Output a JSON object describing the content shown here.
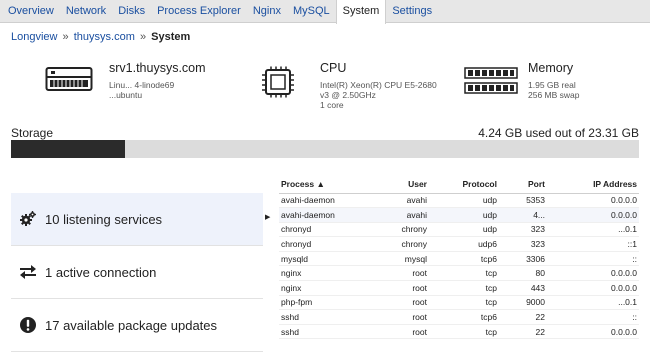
{
  "tabs": [
    {
      "label": "Overview",
      "active": false
    },
    {
      "label": "Network",
      "active": false
    },
    {
      "label": "Disks",
      "active": false
    },
    {
      "label": "Process Explorer",
      "active": false
    },
    {
      "label": "Nginx",
      "active": false
    },
    {
      "label": "MySQL",
      "active": false
    },
    {
      "label": "System",
      "active": true
    },
    {
      "label": "Settings",
      "active": false
    }
  ],
  "breadcrumb": {
    "root": "Longview",
    "host": "thuysys.com",
    "separator": "»",
    "current": "System"
  },
  "server": {
    "hostname": "srv1.thuysys.com",
    "line1": "Linu... 4-linode69",
    "line2": "...ubuntu"
  },
  "cpu": {
    "title": "CPU",
    "model": "Intel(R) Xeon(R) CPU E5-2680",
    "speed": "v3 @ 2.50GHz",
    "cores": "1 core"
  },
  "memory": {
    "title": "Memory",
    "real": "1.95 GB real",
    "swap": "256 MB swap"
  },
  "storage": {
    "label": "Storage",
    "used_text": "4.24 GB used out of 23.31 GB",
    "used_fraction": 0.182
  },
  "stats": [
    {
      "label": "10 listening services",
      "icon": "gears-icon",
      "active": true
    },
    {
      "label": "1 active connection",
      "icon": "arrows-exchange-icon",
      "active": false
    },
    {
      "label": "17 available package updates",
      "icon": "alert-circle-icon",
      "active": false
    }
  ],
  "table": {
    "headers": {
      "process": "Process ▲",
      "user": "User",
      "protocol": "Protocol",
      "port": "Port",
      "ip": "IP Address"
    },
    "rows": [
      {
        "process": "avahi-daemon",
        "user": "avahi",
        "protocol": "udp",
        "port": "5353",
        "ip": "0.0.0.0"
      },
      {
        "process": "avahi-daemon",
        "user": "avahi",
        "protocol": "udp",
        "port": "4...",
        "ip": "0.0.0.0"
      },
      {
        "process": "chronyd",
        "user": "chrony",
        "protocol": "udp",
        "port": "323",
        "ip": "...0.1"
      },
      {
        "process": "chronyd",
        "user": "chrony",
        "protocol": "udp6",
        "port": "323",
        "ip": "::1"
      },
      {
        "process": "mysqld",
        "user": "mysql",
        "protocol": "tcp6",
        "port": "3306",
        "ip": "::"
      },
      {
        "process": "nginx",
        "user": "root",
        "protocol": "tcp",
        "port": "80",
        "ip": "0.0.0.0"
      },
      {
        "process": "nginx",
        "user": "root",
        "protocol": "tcp",
        "port": "443",
        "ip": "0.0.0.0"
      },
      {
        "process": "php-fpm",
        "user": "root",
        "protocol": "tcp",
        "port": "9000",
        "ip": "...0.1"
      },
      {
        "process": "sshd",
        "user": "root",
        "protocol": "tcp6",
        "port": "22",
        "ip": "::"
      },
      {
        "process": "sshd",
        "user": "root",
        "protocol": "tcp",
        "port": "22",
        "ip": "0.0.0.0"
      }
    ]
  },
  "colors": {
    "link": "#1a4fa0",
    "tabbar_bg": "#e7e7e7",
    "storage_fill": "#2b2b2b",
    "storage_track": "#dcdcdc",
    "active_stat_bg": "#eef2fb"
  }
}
